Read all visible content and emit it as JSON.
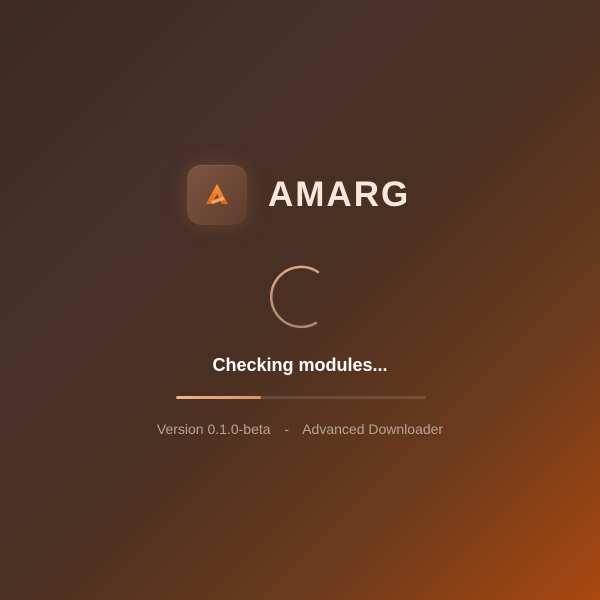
{
  "app": {
    "name": "AMARG",
    "logo_icon": "amarg-logo-icon"
  },
  "loader": {
    "status": "Checking modules...",
    "progress": 0.34,
    "spinner_icon": "spinner-icon"
  },
  "footer": {
    "version": "Version 0.1.0-beta",
    "separator": "-",
    "tagline": "Advanced Downloader"
  },
  "colors": {
    "accent": "#f07a1f",
    "text_primary": "#fae6da",
    "progress_fill": "#e8a277",
    "background_dark": "#3d2a22",
    "background_glow": "#a9480f"
  }
}
